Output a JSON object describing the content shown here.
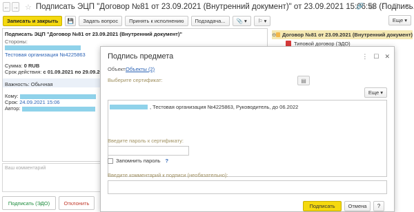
{
  "window": {
    "title": "Подписать ЭЦП \"Договор №81 от 23.09.2021 (Внутренний документ)\" от 23.09.2021 15:06:58 (Подпись..."
  },
  "toolbar": {
    "sign_close": "Записать и закрыть",
    "ask_question": "Задать вопрос",
    "accept_exec": "Принять к исполнению",
    "subtask": "Подзадача...",
    "more": "Еще"
  },
  "left": {
    "doc_head": "Подписать ЭЦП \"Договор №81 от 23.09.2021 (Внутренний документ)\"",
    "parties_label": "Стороны:",
    "org_name": "Тестовая организация №4225863",
    "sum_label": "Сумма:",
    "sum_value": "0 RUB",
    "validity_label": "Срок действия:",
    "validity_value": "с 01.09.2021 по 29.09.2021",
    "importance_label": "Важность:",
    "importance_value": "Обычная",
    "to_label": "Кому:",
    "due_label": "Срок:",
    "due_value": "24.09.2021 15:06",
    "author_label": "Автор:",
    "comment_placeholder": "Ваш комментарий",
    "sign_edo_btn": "Подписать (ЭДО)",
    "reject_btn": "Отклонить"
  },
  "right": {
    "tree_root": "Договор №81 от 23.09.2021 (Внутренний документ)",
    "tree_child": "Типовой договор (ЭДО)"
  },
  "dialog": {
    "title": "Подпись предмета",
    "object_label": "Объект:",
    "object_link": "Объекты (2)",
    "cert_label": "Выберите сертификат:",
    "more_label": "Еще",
    "cert_text": ", Тестовая организация №4225863, Руководитель, до 06.2022",
    "password_label": "Введите пароль к сертификату:",
    "remember_label": "Запомнить пароль",
    "help_q": "?",
    "comment_label": "Введите комментарий к подписи (необязательно):",
    "sign_btn": "Подписать",
    "cancel_btn": "Отмена",
    "help_btn": "?"
  },
  "colors": {
    "primary_button": "#f5d90f",
    "link": "#2a62b5",
    "redacted": "#8fd2ea",
    "tree_selected": "#f5e9b3",
    "sign_edo": "#1a8a3a",
    "reject": "#c0392b"
  }
}
